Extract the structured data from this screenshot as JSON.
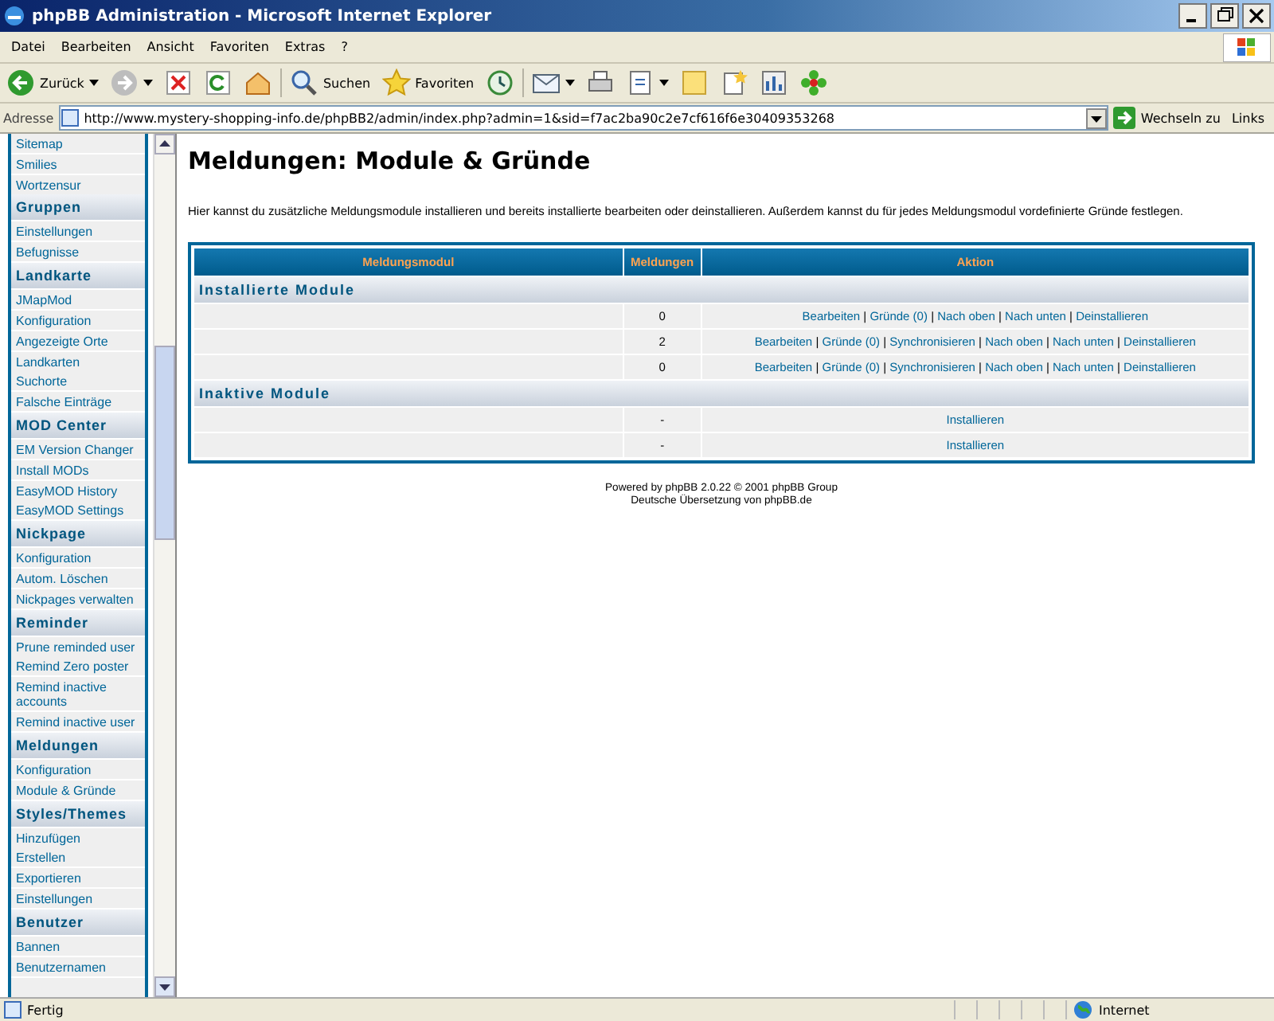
{
  "window": {
    "title": "phpBB Administration - Microsoft Internet Explorer"
  },
  "menu_bar": [
    "Datei",
    "Bearbeiten",
    "Ansicht",
    "Favoriten",
    "Extras",
    "?"
  ],
  "toolbar": [
    {
      "kind": "back",
      "label": "Zurück"
    },
    {
      "kind": "forward"
    },
    {
      "kind": "stop"
    },
    {
      "kind": "refresh"
    },
    {
      "kind": "home"
    },
    {
      "kind": "search",
      "label": "Suchen"
    },
    {
      "kind": "favorites",
      "label": "Favoriten"
    },
    {
      "kind": "history"
    },
    {
      "kind": "mail"
    },
    {
      "kind": "print"
    },
    {
      "kind": "edit"
    },
    {
      "kind": "note"
    },
    {
      "kind": "research"
    },
    {
      "kind": "tools"
    },
    {
      "kind": "flower"
    }
  ],
  "address_bar": {
    "label": "Adresse",
    "value": "http://www.mystery-shopping-info.de/phpBB2/admin/index.php?admin=1&sid=f7ac2ba90c2e7cf616f6e30409353268",
    "go": "Wechseln zu",
    "links": "Links"
  },
  "sidebar": {
    "items": [
      "Sitemap",
      "Smilies",
      "Wortzensur"
    ],
    "sections": [
      {
        "title": "Gruppen",
        "items": [
          "Einstellungen",
          "Befugnisse"
        ]
      },
      {
        "title": "Landkarte",
        "items": [
          "JMapMod",
          "Konfiguration",
          "Angezeigte Orte",
          "Landkarten",
          "Suchorte",
          "Falsche Einträge"
        ]
      },
      {
        "title": "MOD Center",
        "items": [
          "EM Version Changer",
          "Install MODs",
          "EasyMOD History",
          "EasyMOD Settings"
        ]
      },
      {
        "title": "Nickpage",
        "items": [
          "Konfiguration",
          "Autom. Löschen",
          "Nickpages verwalten"
        ]
      },
      {
        "title": "Reminder",
        "items": [
          "Prune reminded user",
          "Remind Zero poster",
          "Remind inactive accounts",
          "Remind inactive user"
        ]
      },
      {
        "title": "Meldungen",
        "items": [
          "Konfiguration",
          "Module & Gründe"
        ]
      },
      {
        "title": "Styles/Themes",
        "items": [
          "Hinzufügen",
          "Erstellen",
          "Exportieren",
          "Einstellungen"
        ]
      },
      {
        "title": "Benutzer",
        "items": [
          "Bannen",
          "Benutzernamen"
        ]
      }
    ]
  },
  "main": {
    "title": "Meldungen: Module & Gründe",
    "description": "Hier kannst du zusätzliche Meldungsmodule installieren und bereits installierte bearbeiten oder deinstallieren. Außerdem kannst du für jedes Meldungsmodul vordefinierte Gründe festlegen.",
    "table": {
      "columns": [
        "Meldungsmodul",
        "Meldungen",
        "Aktion"
      ],
      "separator": "|",
      "groups": [
        {
          "title": "Installierte Module",
          "rows": [
            {
              "count": "0",
              "actions": [
                "Bearbeiten",
                "Gründe (0)",
                "Nach oben",
                "Nach unten",
                "Deinstallieren"
              ]
            },
            {
              "count": "2",
              "actions": [
                "Bearbeiten",
                "Gründe (0)",
                "Synchronisieren",
                "Nach oben",
                "Nach unten",
                "Deinstallieren"
              ]
            },
            {
              "count": "0",
              "actions": [
                "Bearbeiten",
                "Gründe (0)",
                "Synchronisieren",
                "Nach oben",
                "Nach unten",
                "Deinstallieren"
              ]
            }
          ]
        },
        {
          "title": "Inaktive Module",
          "rows": [
            {
              "count": "-",
              "actions": [
                "Installieren"
              ]
            },
            {
              "count": "-",
              "actions": [
                "Installieren"
              ]
            }
          ]
        }
      ]
    },
    "footer": [
      "Powered by phpBB 2.0.22 © 2001 phpBB Group",
      "Deutsche Übersetzung von phpBB.de"
    ]
  },
  "status_bar": {
    "text": "Fertig",
    "zone": "Internet"
  }
}
